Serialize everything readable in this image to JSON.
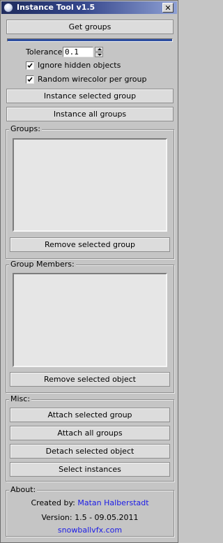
{
  "window": {
    "title": "Instance Tool v1.5",
    "close_glyph": "✕",
    "icon": "app-sphere-icon"
  },
  "top": {
    "get_groups_label": "Get groups",
    "progress_fraction": 1.0,
    "progress_color": "#2e4ea1",
    "tolerance_label": "Tolerance:",
    "tolerance_value": "0.1",
    "ignore_hidden_label": "Ignore hidden objects",
    "ignore_hidden_checked": true,
    "random_wirecolor_label": "Random wirecolor per group",
    "random_wirecolor_checked": true,
    "instance_selected_label": "Instance selected group",
    "instance_all_label": "Instance all groups"
  },
  "groups": {
    "title": "Groups:",
    "items": [],
    "remove_label": "Remove selected group"
  },
  "members": {
    "title": "Group Members:",
    "items": [],
    "remove_label": "Remove selected object"
  },
  "misc": {
    "title": "Misc:",
    "attach_selected_label": "Attach selected group",
    "attach_all_label": "Attach all groups",
    "detach_selected_label": "Detach selected object",
    "select_instances_label": "Select instances"
  },
  "about": {
    "title": "About:",
    "created_by_label": "Created by:",
    "author": "Matan Halberstadt",
    "version_text": "Version: 1.5  -  09.05.2011",
    "website": "snowballvfx.com",
    "link_color": "#1a1ae6"
  }
}
